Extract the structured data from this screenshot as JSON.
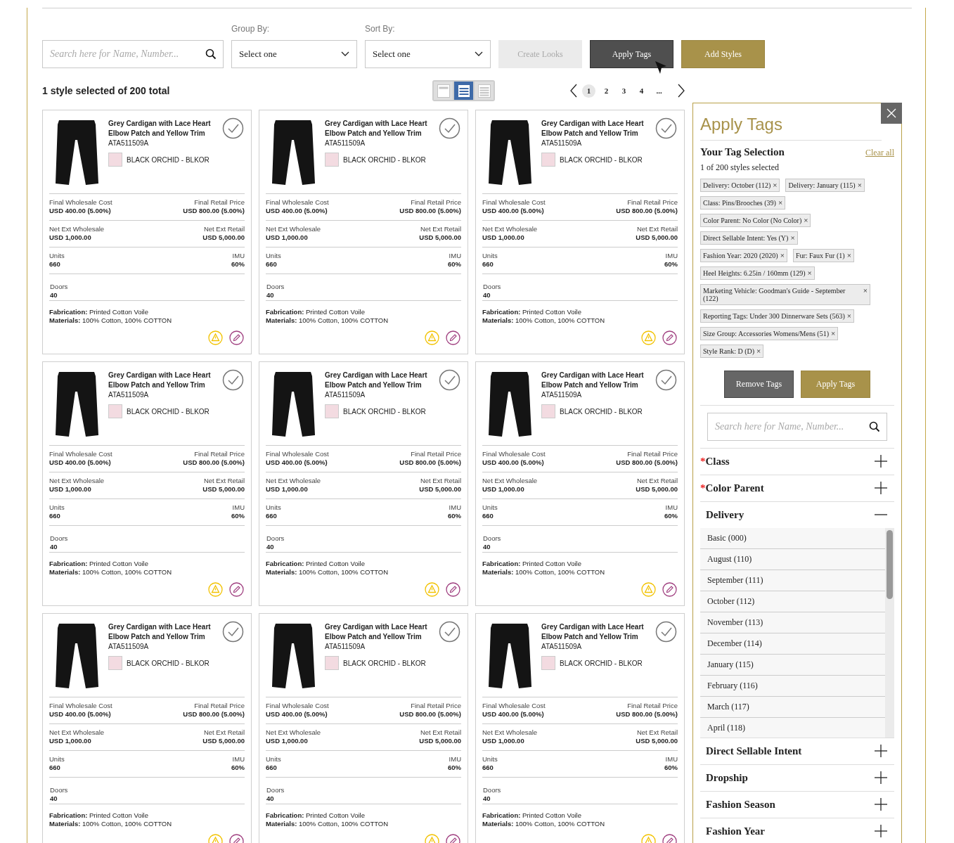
{
  "toolbar": {
    "search": {
      "placeholder": "Search here for Name, Number..."
    },
    "group_by": {
      "label": "Group By:",
      "value": "Select one"
    },
    "sort_by": {
      "label": "Sort By:",
      "value": "Select one"
    },
    "buttons": [
      {
        "label": "Create Looks",
        "kind": "disabled"
      },
      {
        "label": "Apply Tags",
        "kind": "dark"
      },
      {
        "label": "Add Styles",
        "kind": "gold"
      }
    ]
  },
  "selection_summary": "1 style selected of 200 total",
  "view_modes": [
    {
      "kind": "single",
      "selected": false
    },
    {
      "kind": "list",
      "selected": true
    },
    {
      "kind": "dense",
      "selected": false
    }
  ],
  "pagination": {
    "pages": [
      {
        "label": "1",
        "selected": true
      },
      {
        "label": "2",
        "selected": false
      },
      {
        "label": "3",
        "selected": false
      },
      {
        "label": "4",
        "selected": false
      },
      {
        "label": "...",
        "selected": false
      }
    ]
  },
  "cards": [
    {
      "title": "Grey Cardigan with Lace Heart Elbow Patch and Yellow Trim",
      "style_number": "ATA511509A",
      "color_name": "BLACK ORCHID - BLKOR",
      "rows": [
        {
          "cells": [
            {
              "label": "Final Wholesale Cost",
              "value": "USD 400.00 (5.00%)"
            },
            {
              "label": "Final Retail Price",
              "value": "USD 800.00 (5.00%)"
            }
          ]
        },
        {
          "cells": [
            {
              "label": "Net Ext Wholesale",
              "value": "USD 1,000.00"
            },
            {
              "label": "Net Ext Retail",
              "value": "USD 5,000.00"
            }
          ]
        },
        {
          "cells": [
            {
              "label": "Units",
              "value": "660"
            },
            {
              "label": "IMU",
              "value": "60%"
            }
          ]
        },
        {
          "cells": [
            {
              "label": "Doors",
              "value": "40"
            }
          ]
        }
      ],
      "fabrication": "**Fabrication:** Printed Cotton Voile",
      "materials": "**Materials:** 100% Cotton, 100% COTTON"
    },
    {
      "title": "Grey Cardigan with Lace Heart Elbow Patch and Yellow Trim",
      "style_number": "ATA511509A",
      "color_name": "BLACK ORCHID - BLKOR",
      "rows": [
        {
          "cells": [
            {
              "label": "Final Wholesale Cost",
              "value": "USD 400.00 (5.00%)"
            },
            {
              "label": "Final Retail Price",
              "value": "USD 800.00 (5.00%)"
            }
          ]
        },
        {
          "cells": [
            {
              "label": "Net Ext Wholesale",
              "value": "USD 1,000.00"
            },
            {
              "label": "Net Ext Retail",
              "value": "USD 5,000.00"
            }
          ]
        },
        {
          "cells": [
            {
              "label": "Units",
              "value": "660"
            },
            {
              "label": "IMU",
              "value": "60%"
            }
          ]
        },
        {
          "cells": [
            {
              "label": "Doors",
              "value": "40"
            }
          ]
        }
      ],
      "fabrication": "**Fabrication:** Printed Cotton Voile",
      "materials": "**Materials:** 100% Cotton, 100% COTTON"
    },
    {
      "title": "Grey Cardigan with Lace Heart Elbow Patch and Yellow Trim",
      "style_number": "ATA511509A",
      "color_name": "BLACK ORCHID - BLKOR",
      "rows": [
        {
          "cells": [
            {
              "label": "Final Wholesale Cost",
              "value": "USD 400.00 (5.00%)"
            },
            {
              "label": "Final Retail Price",
              "value": "USD 800.00 (5.00%)"
            }
          ]
        },
        {
          "cells": [
            {
              "label": "Net Ext Wholesale",
              "value": "USD 1,000.00"
            },
            {
              "label": "Net Ext Retail",
              "value": "USD 5,000.00"
            }
          ]
        },
        {
          "cells": [
            {
              "label": "Units",
              "value": "660"
            },
            {
              "label": "IMU",
              "value": "60%"
            }
          ]
        },
        {
          "cells": [
            {
              "label": "Doors",
              "value": "40"
            }
          ]
        }
      ],
      "fabrication": "**Fabrication:** Printed Cotton Voile",
      "materials": "**Materials:** 100% Cotton, 100% COTTON"
    },
    {
      "title": "Grey Cardigan with Lace Heart Elbow Patch and Yellow Trim",
      "style_number": "ATA511509A",
      "color_name": "BLACK ORCHID - BLKOR",
      "rows": [
        {
          "cells": [
            {
              "label": "Final Wholesale Cost",
              "value": "USD 400.00 (5.00%)"
            },
            {
              "label": "Final Retail Price",
              "value": "USD 800.00 (5.00%)"
            }
          ]
        },
        {
          "cells": [
            {
              "label": "Net Ext Wholesale",
              "value": "USD 1,000.00"
            },
            {
              "label": "Net Ext Retail",
              "value": "USD 5,000.00"
            }
          ]
        },
        {
          "cells": [
            {
              "label": "Units",
              "value": "660"
            },
            {
              "label": "IMU",
              "value": "60%"
            }
          ]
        },
        {
          "cells": [
            {
              "label": "Doors",
              "value": "40"
            }
          ]
        }
      ],
      "fabrication": "**Fabrication:** Printed Cotton Voile",
      "materials": "**Materials:** 100% Cotton, 100% COTTON"
    },
    {
      "title": "Grey Cardigan with Lace Heart Elbow Patch and Yellow Trim",
      "style_number": "ATA511509A",
      "color_name": "BLACK ORCHID - BLKOR",
      "rows": [
        {
          "cells": [
            {
              "label": "Final Wholesale Cost",
              "value": "USD 400.00 (5.00%)"
            },
            {
              "label": "Final Retail Price",
              "value": "USD 800.00 (5.00%)"
            }
          ]
        },
        {
          "cells": [
            {
              "label": "Net Ext Wholesale",
              "value": "USD 1,000.00"
            },
            {
              "label": "Net Ext Retail",
              "value": "USD 5,000.00"
            }
          ]
        },
        {
          "cells": [
            {
              "label": "Units",
              "value": "660"
            },
            {
              "label": "IMU",
              "value": "60%"
            }
          ]
        },
        {
          "cells": [
            {
              "label": "Doors",
              "value": "40"
            }
          ]
        }
      ],
      "fabrication": "**Fabrication:** Printed Cotton Voile",
      "materials": "**Materials:** 100% Cotton, 100% COTTON"
    },
    {
      "title": "Grey Cardigan with Lace Heart Elbow Patch and Yellow Trim",
      "style_number": "ATA511509A",
      "color_name": "BLACK ORCHID - BLKOR",
      "rows": [
        {
          "cells": [
            {
              "label": "Final Wholesale Cost",
              "value": "USD 400.00 (5.00%)"
            },
            {
              "label": "Final Retail Price",
              "value": "USD 800.00 (5.00%)"
            }
          ]
        },
        {
          "cells": [
            {
              "label": "Net Ext Wholesale",
              "value": "USD 1,000.00"
            },
            {
              "label": "Net Ext Retail",
              "value": "USD 5,000.00"
            }
          ]
        },
        {
          "cells": [
            {
              "label": "Units",
              "value": "660"
            },
            {
              "label": "IMU",
              "value": "60%"
            }
          ]
        },
        {
          "cells": [
            {
              "label": "Doors",
              "value": "40"
            }
          ]
        }
      ],
      "fabrication": "**Fabrication:** Printed Cotton Voile",
      "materials": "**Materials:** 100% Cotton, 100% COTTON"
    },
    {
      "title": "Grey Cardigan with Lace Heart Elbow Patch and Yellow Trim",
      "style_number": "ATA511509A",
      "color_name": "BLACK ORCHID - BLKOR",
      "rows": [
        {
          "cells": [
            {
              "label": "Final Wholesale Cost",
              "value": "USD 400.00 (5.00%)"
            },
            {
              "label": "Final Retail Price",
              "value": "USD 800.00 (5.00%)"
            }
          ]
        },
        {
          "cells": [
            {
              "label": "Net Ext Wholesale",
              "value": "USD 1,000.00"
            },
            {
              "label": "Net Ext Retail",
              "value": "USD 5,000.00"
            }
          ]
        },
        {
          "cells": [
            {
              "label": "Units",
              "value": "660"
            },
            {
              "label": "IMU",
              "value": "60%"
            }
          ]
        },
        {
          "cells": [
            {
              "label": "Doors",
              "value": "40"
            }
          ]
        }
      ],
      "fabrication": "**Fabrication:** Printed Cotton Voile",
      "materials": "**Materials:** 100% Cotton, 100% COTTON"
    },
    {
      "title": "Grey Cardigan with Lace Heart Elbow Patch and Yellow Trim",
      "style_number": "ATA511509A",
      "color_name": "BLACK ORCHID - BLKOR",
      "rows": [
        {
          "cells": [
            {
              "label": "Final Wholesale Cost",
              "value": "USD 400.00 (5.00%)"
            },
            {
              "label": "Final Retail Price",
              "value": "USD 800.00 (5.00%)"
            }
          ]
        },
        {
          "cells": [
            {
              "label": "Net Ext Wholesale",
              "value": "USD 1,000.00"
            },
            {
              "label": "Net Ext Retail",
              "value": "USD 5,000.00"
            }
          ]
        },
        {
          "cells": [
            {
              "label": "Units",
              "value": "660"
            },
            {
              "label": "IMU",
              "value": "60%"
            }
          ]
        },
        {
          "cells": [
            {
              "label": "Doors",
              "value": "40"
            }
          ]
        }
      ],
      "fabrication": "**Fabrication:** Printed Cotton Voile",
      "materials": "**Materials:** 100% Cotton, 100% COTTON"
    },
    {
      "title": "Grey Cardigan with Lace Heart Elbow Patch and Yellow Trim",
      "style_number": "ATA511509A",
      "color_name": "BLACK ORCHID - BLKOR",
      "rows": [
        {
          "cells": [
            {
              "label": "Final Wholesale Cost",
              "value": "USD 400.00 (5.00%)"
            },
            {
              "label": "Final Retail Price",
              "value": "USD 800.00 (5.00%)"
            }
          ]
        },
        {
          "cells": [
            {
              "label": "Net Ext Wholesale",
              "value": "USD 1,000.00"
            },
            {
              "label": "Net Ext Retail",
              "value": "USD 5,000.00"
            }
          ]
        },
        {
          "cells": [
            {
              "label": "Units",
              "value": "660"
            },
            {
              "label": "IMU",
              "value": "60%"
            }
          ]
        },
        {
          "cells": [
            {
              "label": "Doors",
              "value": "40"
            }
          ]
        }
      ],
      "fabrication": "**Fabrication:** Printed Cotton Voile",
      "materials": "**Materials:** 100% Cotton, 100% COTTON"
    }
  ],
  "panel": {
    "title": "Apply Tags",
    "required_marker": "*",
    "selection_title": "Your Tag Selection",
    "clear_all": "Clear all",
    "count": "1 of 200 styles selected",
    "tags": [
      {
        "label": "Delivery: October (112)",
        "remove": "×"
      },
      {
        "label": "Delivery: January (115)",
        "remove": "×"
      },
      {
        "label": "Class: Pins/Brooches (39)",
        "remove": "×"
      },
      {
        "label": "Color Parent: No Color (No Color)",
        "remove": "×"
      },
      {
        "label": "Direct Sellable Intent: Yes (Y)",
        "remove": "×"
      },
      {
        "label": "Fashion Year: 2020 (2020)",
        "remove": "×"
      },
      {
        "label": "Fur: Faux Fur (1)",
        "remove": "×"
      },
      {
        "label": "Heel Heights: 6.25in / 160mm (129)",
        "remove": "×"
      },
      {
        "label": "Marketing Vehicle: Goodman's Guide - September (122)",
        "remove": "×"
      },
      {
        "label": "Reporting Tags: Under 300 Dinnerware Sets (563)",
        "remove": "×"
      },
      {
        "label": "Size Group: Accessories Womens/Mens (51)",
        "remove": "×"
      },
      {
        "label": "Style Rank: D (D)",
        "remove": "×"
      }
    ],
    "buttons": [
      {
        "label": "Remove Tags",
        "kind": "dark"
      },
      {
        "label": "Apply Tags",
        "kind": "gold"
      }
    ],
    "search": {
      "placeholder": "Search here for Name, Number..."
    },
    "sections": [
      {
        "title": "Class",
        "required": true,
        "expanded": false
      },
      {
        "title": "Color Parent",
        "required": true,
        "expanded": false
      },
      {
        "title": "Delivery",
        "required": false,
        "expanded": true,
        "options": [
          "Basic (000)",
          "August (110)",
          "September (111)",
          "October (112)",
          "November (113)",
          "December (114)",
          "January (115)",
          "February (116)",
          "March (117)",
          "April (118)"
        ]
      },
      {
        "title": "Direct Sellable Intent",
        "required": false,
        "expanded": false
      },
      {
        "title": "Dropship",
        "required": false,
        "expanded": false
      },
      {
        "title": "Fashion Season",
        "required": false,
        "expanded": false
      },
      {
        "title": "Fashion Year",
        "required": false,
        "expanded": false
      }
    ]
  }
}
